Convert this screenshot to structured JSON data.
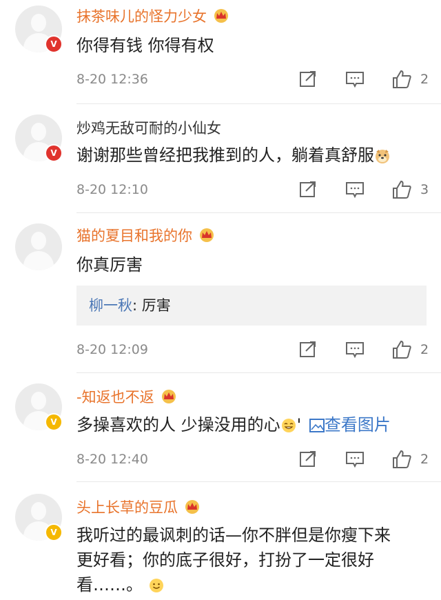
{
  "comments": [
    {
      "user": "抹茶味儿的怪力少女",
      "text": "你得有钱 你得有权",
      "time": "8-20 12:36",
      "likes": "2",
      "badge": "red",
      "user_color": "orange",
      "crown": true
    },
    {
      "user": "炒鸡无敌可耐的小仙女",
      "text": "谢谢那些曾经把我推到的人，躺着真舒服",
      "time": "8-20 12:10",
      "likes": "3",
      "badge": "red",
      "user_color": "plain",
      "crown": false,
      "emoji": "doge-emoji"
    },
    {
      "user": "猫的夏目和我的你",
      "text": "你真厉害",
      "time": "8-20 12:09",
      "likes": "2",
      "badge": null,
      "user_color": "orange",
      "crown": true,
      "reply": {
        "name": "柳一秋",
        "sep": ": ",
        "text": "厉害"
      }
    },
    {
      "user": "-知返也不返",
      "text": "多操喜欢的人  少操没用的心",
      "text_suffix": "'",
      "view_pic": "查看图片",
      "time": "8-20 12:40",
      "likes": "2",
      "badge": "gold",
      "user_color": "orange",
      "crown": true,
      "emoji": "grin-emoji"
    },
    {
      "user": "头上长草的豆瓜",
      "text_lines": [
        "我听过的最讽刺的话—你不胖但是你瘦下来",
        "更好看；你的底子很好，打扮了一定很好",
        "看……。"
      ],
      "badge": "gold",
      "user_color": "orange",
      "crown": true,
      "emoji": "smile-emoji"
    }
  ],
  "colors": {
    "username": "#e8732b",
    "badge_red": "#e0332d",
    "badge_gold": "#f5b800",
    "link": "#3c78c8"
  },
  "icons": [
    "forward-icon",
    "comment-icon",
    "like-icon",
    "crown-icon",
    "avatar-placeholder-icon",
    "image-icon"
  ]
}
